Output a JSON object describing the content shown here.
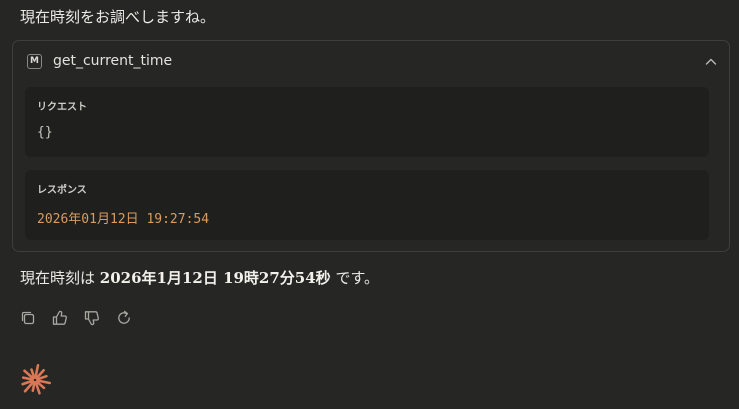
{
  "message": {
    "intro": "現在時刻をお調べしますね。",
    "answer_prefix": "現在時刻は ",
    "answer_value": "2026年1月12日 19時27分54秒",
    "answer_suffix": " です。"
  },
  "tool_call": {
    "icon_letter": "M",
    "name": "get_current_time",
    "request_label": "リクエスト",
    "request_body": "{}",
    "response_label": "レスポンス",
    "response_body": "2026年01月12日 19:27:54"
  },
  "actions": {
    "copy": "copy-icon",
    "thumbs_up": "thumbs-up-icon",
    "thumbs_down": "thumbs-down-icon",
    "retry": "retry-icon"
  },
  "colors": {
    "background": "#262624",
    "panel": "#1f1f1d",
    "accent": "#d97757",
    "response_text": "#d99c5e"
  }
}
